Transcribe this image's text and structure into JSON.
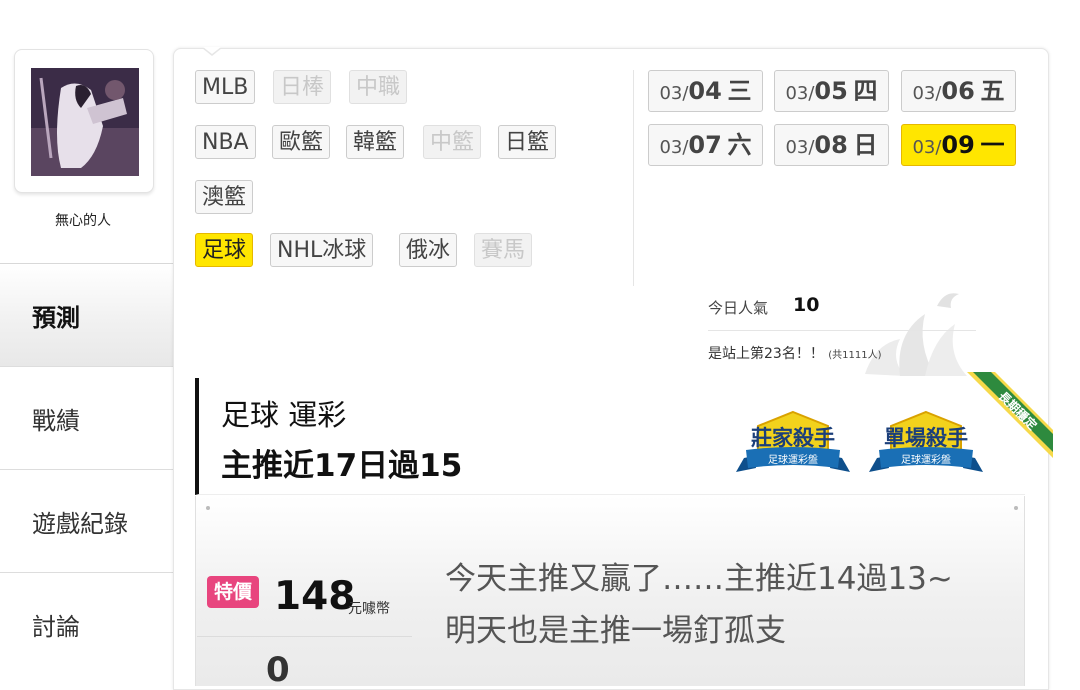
{
  "profile": {
    "username": "無心的人"
  },
  "nav": {
    "items": [
      {
        "label": "預測",
        "active": true
      },
      {
        "label": "戰績",
        "active": false
      },
      {
        "label": "遊戲紀錄",
        "active": false
      },
      {
        "label": "討論",
        "active": false
      }
    ]
  },
  "sports": {
    "row1": [
      {
        "label": "MLB",
        "state": "normal"
      },
      {
        "label": "日棒",
        "state": "disabled"
      },
      {
        "label": "中職",
        "state": "disabled"
      }
    ],
    "row2": [
      {
        "label": "NBA",
        "state": "normal"
      },
      {
        "label": "歐籃",
        "state": "normal"
      },
      {
        "label": "韓籃",
        "state": "normal"
      },
      {
        "label": "中籃",
        "state": "disabled"
      },
      {
        "label": "日籃",
        "state": "normal"
      }
    ],
    "row3": [
      {
        "label": "澳籃",
        "state": "normal"
      }
    ],
    "row4": [
      {
        "label": "足球",
        "state": "active"
      },
      {
        "label": "NHL冰球",
        "state": "normal"
      },
      {
        "label": "俄冰",
        "state": "normal"
      },
      {
        "label": "賽馬",
        "state": "disabled"
      }
    ]
  },
  "dates": [
    {
      "month": "03/",
      "day": "04",
      "weekday": "三",
      "active": false
    },
    {
      "month": "03/",
      "day": "05",
      "weekday": "四",
      "active": false
    },
    {
      "month": "03/",
      "day": "06",
      "weekday": "五",
      "active": false
    },
    {
      "month": "03/",
      "day": "07",
      "weekday": "六",
      "active": false
    },
    {
      "month": "03/",
      "day": "08",
      "weekday": "日",
      "active": false
    },
    {
      "month": "03/",
      "day": "09",
      "weekday": "一",
      "active": true
    }
  ],
  "stats": {
    "popularity_label": "今日人氣",
    "popularity_value": "10",
    "rank_text": "是站上第23名！！",
    "rank_total": "(共1111人)"
  },
  "title": {
    "line1": "足球 運彩",
    "line2": "主推近17日過15"
  },
  "badges": [
    {
      "main": "莊家殺手",
      "sub": "足球運彩盤"
    },
    {
      "main": "單場殺手",
      "sub": "足球運彩盤"
    }
  ],
  "ribbon": {
    "label": "長期穩定"
  },
  "price": {
    "promo_label": "特價",
    "value": "148",
    "unit": "元噱幣",
    "count": "0"
  },
  "message": "今天主推又贏了……主推近14過13~\n明天也是主推一場釘孤支",
  "colors": {
    "active_yellow": "#ffe600",
    "promo_pink": "#e8457e",
    "badge_gold": "#f2d21c",
    "badge_blue": "#1a6fb5"
  }
}
